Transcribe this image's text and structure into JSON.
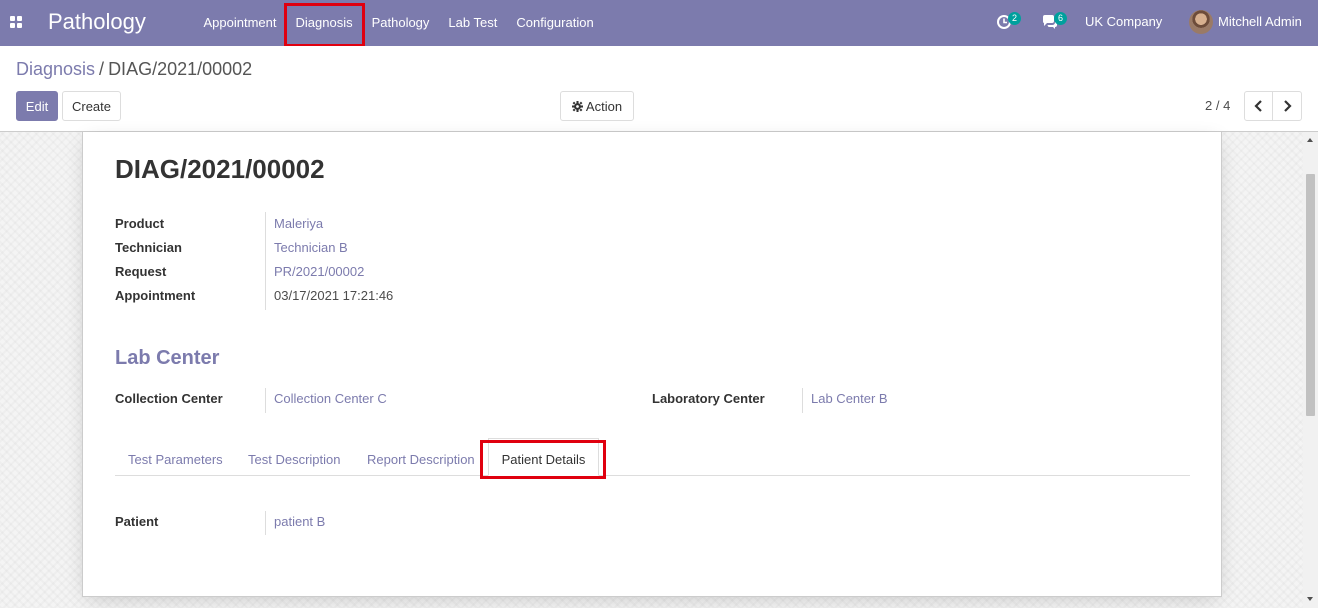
{
  "navbar": {
    "brand": "Pathology",
    "menu": [
      "Appointment",
      "Diagnosis",
      "Pathology",
      "Lab Test",
      "Configuration"
    ],
    "activities_count": "2",
    "messages_count": "6",
    "company": "UK Company",
    "user": "Mitchell Admin",
    "icons": {
      "apps": "apps-grid-icon",
      "activity": "clock-activity-icon",
      "messages": "chat-bubbles-icon"
    }
  },
  "control": {
    "breadcrumb_parent": "Diagnosis",
    "breadcrumb_sep": "/",
    "breadcrumb_current": "DIAG/2021/00002",
    "edit_label": "Edit",
    "create_label": "Create",
    "action_label": "Action",
    "pager": "2 / 4"
  },
  "record": {
    "title": "DIAG/2021/00002",
    "fields": [
      {
        "label": "Product",
        "value": "Maleriya"
      },
      {
        "label": "Technician",
        "value": "Technician B"
      },
      {
        "label": "Request",
        "value": "PR/2021/00002"
      },
      {
        "label": "Appointment",
        "value": "03/17/2021 17:21:46"
      }
    ],
    "section_title": "Lab Center",
    "collection_label": "Collection Center",
    "collection_value": "Collection Center C",
    "laboratory_label": "Laboratory Center",
    "laboratory_value": "Lab Center B",
    "tabs": [
      "Test Parameters",
      "Test Description",
      "Report Description",
      "Patient Details"
    ],
    "patient_label": "Patient",
    "patient_value": "patient B"
  },
  "colors": {
    "brand": "#7c7bad",
    "highlight": "#e0000f",
    "badge": "#00a09d"
  }
}
